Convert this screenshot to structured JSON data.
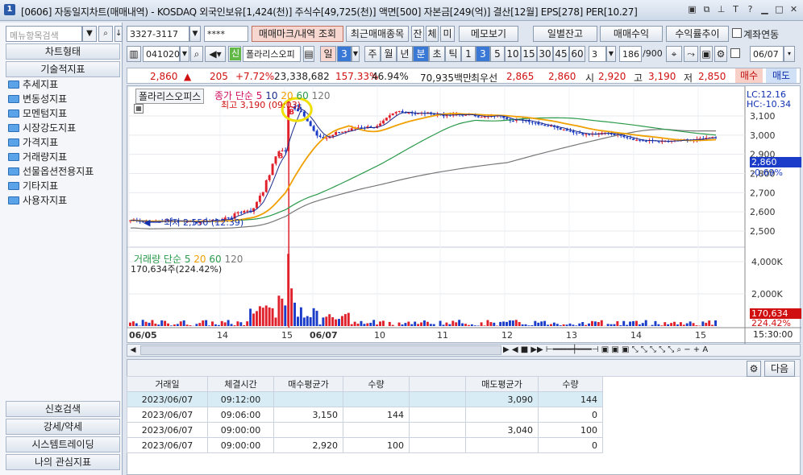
{
  "window": {
    "num": "1",
    "title": "[0606] 자동일지차트(매매내역) - KOSDAQ 외국인보유[1,424(천)] 주식수[49,725(천)] 액면[500] 자본금[249(억)] 결산[12월] EPS[278] PER[10.27]"
  },
  "left": {
    "search_placeholder": "메뉴항목검색",
    "chart_form": "차트형태",
    "tech_indicators": "기술적지표",
    "tree": [
      "추세지표",
      "변동성지표",
      "모멘텀지표",
      "시장강도지표",
      "가격지표",
      "거래량지표",
      "선물옵션전용지표",
      "기타지표",
      "사용자지표"
    ],
    "bottom": [
      "신호검색",
      "강세/약세",
      "시스템트레이딩",
      "나의 관심지표"
    ]
  },
  "toolbar1": {
    "account": "3327-3117",
    "password": "****",
    "trade_mark": "매매마크/내역 조회",
    "recent_items": "최근매매종목",
    "jan": "잔",
    "che": "체",
    "mi": "미",
    "memo": "메모보기",
    "daily_balance": "일별잔고",
    "trade_profit": "매매수익",
    "profit_trend": "수익률추이",
    "account_link": "계좌연동"
  },
  "toolbar2": {
    "code": "041020",
    "sin": "신",
    "name": "폴라리스오피",
    "period": [
      "일",
      "3",
      "주",
      "월",
      "년",
      "분",
      "초",
      "틱"
    ],
    "minutes": [
      "1",
      "3",
      "5",
      "10",
      "15",
      "30",
      "45",
      "60"
    ],
    "count_sel": "3",
    "count": "186",
    "count_total": "/900",
    "date": "06/07"
  },
  "pricebar": {
    "price": "2,860",
    "change": "205",
    "change_pct": "+7.72%",
    "volume": "23,338,682",
    "vol_ratio": "157.33%",
    "rate": "46.94%",
    "amount": "70,935백만",
    "priority": "최우선",
    "ask": "2,865",
    "bid": "2,860",
    "open_l": "시",
    "open": "2,920",
    "high_l": "고",
    "high": "3,190",
    "low_l": "저",
    "low": "2,850",
    "buy": "매수",
    "sell": "매도"
  },
  "chart": {
    "name_tag": "폴라리스오피스",
    "ma_label": "종가 단순 5",
    "ma_periods": [
      "10",
      "20",
      "60",
      "120"
    ],
    "high_note": "최고 3,190 (09:03)",
    "low_note": "최저 2,550 (12:39)",
    "lc": "LC:12.16",
    "hc": "HC:-10.34",
    "price_ticks": [
      "3,100",
      "3,000",
      "2,900",
      "2,800",
      "2,700",
      "2,600",
      "2,500"
    ],
    "cur_price": "2,860",
    "cur_pct": "-0.69%",
    "vol_label": "거래량 단순 5",
    "vol_periods": [
      "20",
      "60",
      "120"
    ],
    "vol_value": "170,634주(224.42%)",
    "vol_ticks": [
      "4,000K",
      "2,000K"
    ],
    "vol_cur": "170,634",
    "vol_pct": "224.42%",
    "x_labels": [
      "06/05",
      "14",
      "15",
      "06/07",
      "10",
      "11",
      "12",
      "13",
      "14",
      "15"
    ],
    "time": "15:30:00",
    "colors": {
      "up": "#e0202a",
      "down": "#1a3cc8",
      "ma5": "#1a2a8c",
      "ma20": "#f0a000",
      "ma60": "#2a9a4a",
      "ma120": "#777777"
    }
  },
  "table": {
    "headers": [
      "거래일",
      "체결시간",
      "매수평균가",
      "수량",
      "",
      "매도평균가",
      "수량"
    ],
    "rows": [
      [
        "2023/06/07",
        "09:12:00",
        "",
        "",
        "",
        "3,090",
        "144"
      ],
      [
        "2023/06/07",
        "09:06:00",
        "3,150",
        "144",
        "",
        "",
        "0"
      ],
      [
        "2023/06/07",
        "09:00:00",
        "",
        "",
        "",
        "3,040",
        "100"
      ],
      [
        "2023/06/07",
        "09:00:00",
        "2,920",
        "100",
        "",
        "",
        "0"
      ]
    ],
    "next": "다음"
  }
}
